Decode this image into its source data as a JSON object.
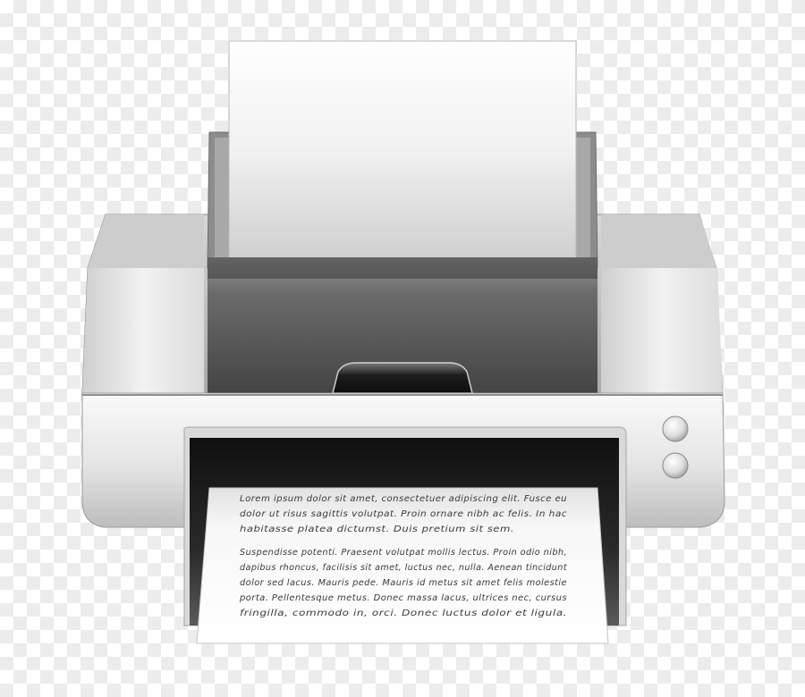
{
  "image": {
    "subject": "printer-icon",
    "colors": {
      "body_light": "#e6e6e6",
      "body_dark": "#4a4a4a",
      "paper": "#f6f6f6",
      "text": "#3a3a3a"
    }
  },
  "output_page": {
    "paragraph_1": [
      "Lorem ipsum dolor sit amet, consectetuer adipiscing elit. Fusce eu",
      "dolor ut risus sagittis volutpat. Proin ornare nibh ac felis. In hac",
      "habitasse platea dictumst. Duis pretium sit sem."
    ],
    "paragraph_2": [
      "Suspendisse potenti. Praesent volutpat mollis lectus. Proin odio nibh,",
      "dapibus rhoncus, facilisis sit amet, luctus nec, nulla. Aenean tincidunt",
      "dolor sed lacus. Mauris pede. Mauris id metus sit amet felis molestie",
      "porta. Pellentesque metus. Donec massa lacus, ultrices nec, cursus",
      "fringilla, commodo in, orci. Donec luctus dolor et ligula."
    ]
  }
}
